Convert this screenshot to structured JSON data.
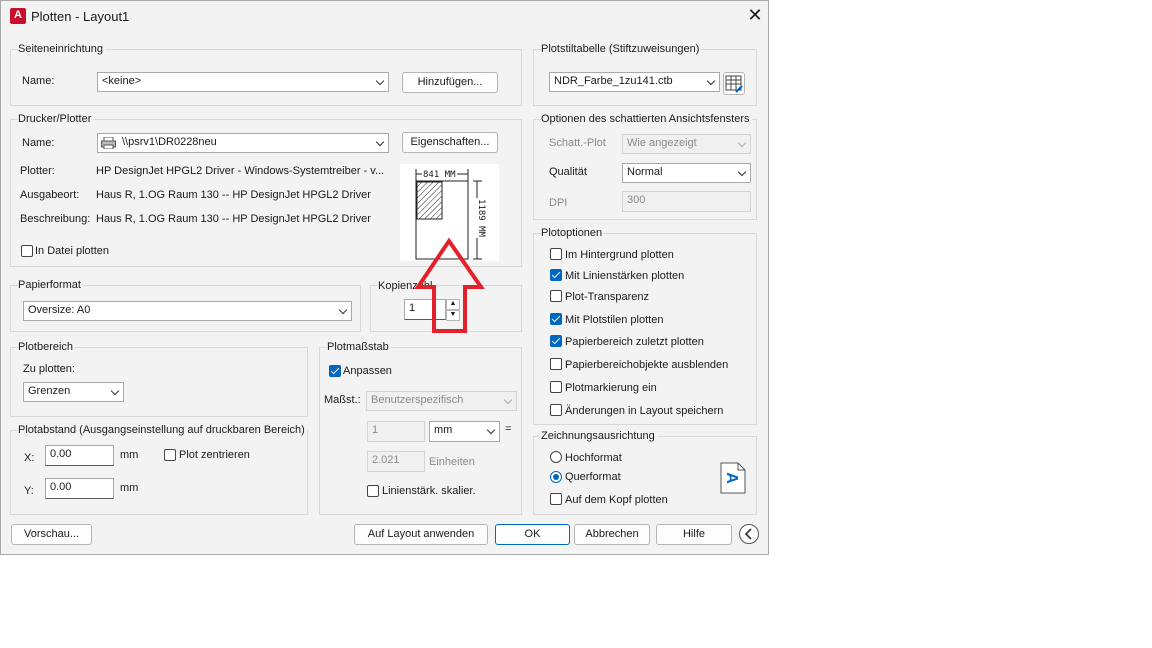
{
  "window": {
    "title": "Plotten - Layout1",
    "app_icon": "A",
    "close_glyph": "✕"
  },
  "page_setup": {
    "title": "Seiteneinrichtung",
    "name_label": "Name:",
    "name_value": "<keine>",
    "add_button": "Hinzufügen..."
  },
  "printer": {
    "title": "Drucker/Plotter",
    "name_label": "Name:",
    "name_value": "\\\\psrv1\\DR0228neu",
    "properties_button": "Eigenschaften...",
    "plotter_label": "Plotter:",
    "plotter_value": "HP DesignJet HPGL2 Driver - Windows-Systemtreiber - v...",
    "location_label": "Ausgabeort:",
    "location_value": "Haus R, 1.OG Raum 130 -- HP DesignJet HPGL2 Driver",
    "description_label": "Beschreibung:",
    "description_value": "Haus R, 1.OG Raum 130 -- HP DesignJet HPGL2 Driver",
    "plot_to_file": "In Datei plotten",
    "preview_width": "841 MM",
    "preview_height": "1189 MM"
  },
  "paper_size": {
    "title": "Papierformat",
    "value": "Oversize: A0"
  },
  "copies": {
    "title": "Kopienzahl",
    "value": "1"
  },
  "plot_area": {
    "title": "Plotbereich",
    "what_label": "Zu plotten:",
    "what_value": "Grenzen"
  },
  "plot_offset": {
    "title": "Plotabstand (Ausgangseinstellung auf druckbaren Bereich)",
    "x_label": "X:",
    "x_value": "0.00",
    "x_unit": "mm",
    "y_label": "Y:",
    "y_value": "0.00",
    "y_unit": "mm",
    "center_plot": "Plot zentrieren"
  },
  "plot_scale": {
    "title": "Plotmaßstab",
    "fit": "Anpassen",
    "scale_label": "Maßst.:",
    "scale_value": "Benutzerspezifisch",
    "value1": "1",
    "unit_value": "mm",
    "equals": "=",
    "value2": "2.021",
    "units_label": "Einheiten",
    "scale_lineweights": "Linienstärk. skalier."
  },
  "plot_style_table": {
    "title": "Plotstiltabelle (Stiftzuweisungen)",
    "value": "NDR_Farbe_1zu141.ctb"
  },
  "shaded_viewport": {
    "title": "Optionen des schattierten Ansichtsfensters",
    "shade_label": "Schatt.-Plot",
    "shade_value": "Wie angezeigt",
    "quality_label": "Qualität",
    "quality_value": "Normal",
    "dpi_label": "DPI",
    "dpi_value": "300"
  },
  "plot_options": {
    "title": "Plotoptionen",
    "items": [
      {
        "label": "Im Hintergrund plotten"
      },
      {
        "label": "Mit Linienstärken plotten"
      },
      {
        "label": "Plot-Transparenz"
      },
      {
        "label": "Mit Plotstilen plotten"
      },
      {
        "label": "Papierbereich zuletzt plotten"
      },
      {
        "label": "Papierbereichobjekte ausblenden"
      },
      {
        "label": "Plotmarkierung ein"
      },
      {
        "label": "Änderungen in Layout speichern"
      }
    ]
  },
  "orientation": {
    "title": "Zeichnungsausrichtung",
    "portrait": "Hochformat",
    "landscape": "Querformat",
    "upside_down": "Auf dem Kopf plotten",
    "icon_letter": "A"
  },
  "buttons": {
    "preview": "Vorschau...",
    "apply": "Auf Layout anwenden",
    "ok": "OK",
    "cancel": "Abbrechen",
    "help": "Hilfe"
  },
  "colors": {
    "accent": "#0067c0",
    "annotation_arrow": "#e3212b"
  }
}
